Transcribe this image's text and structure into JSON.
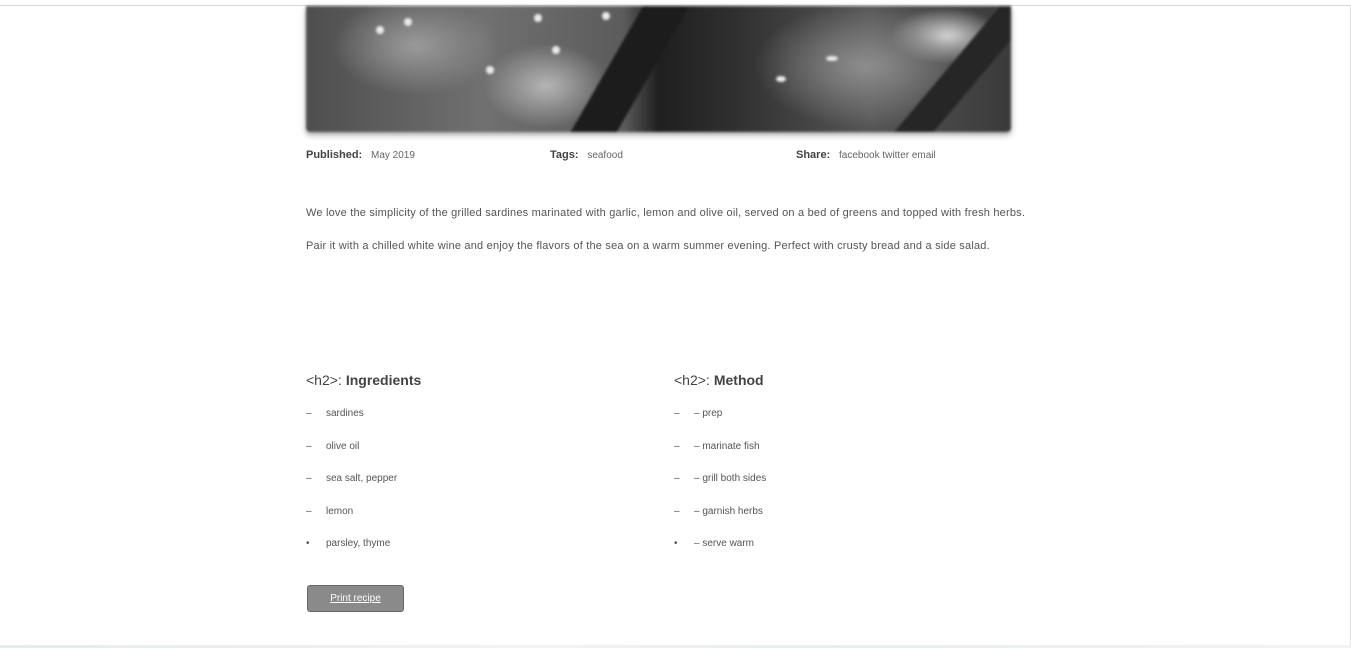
{
  "meta": [
    {
      "label": "Published:",
      "value": "May 2019"
    },
    {
      "label": "Tags:",
      "value": "seafood"
    },
    {
      "label": "Share:",
      "value": "facebook twitter email"
    }
  ],
  "intro": "We love the simplicity of the grilled sardines marinated with garlic, lemon and olive oil, served on a bed of greens and topped with fresh herbs. Pair it with a chilled white wine and enjoy the flavors of the sea on a warm summer evening. Perfect with crusty bread and a side salad.",
  "ingredients": {
    "tag": "<h2>:",
    "title": "Ingredients",
    "items": [
      {
        "mark": "–",
        "text": "sardines"
      },
      {
        "mark": "–",
        "text": "olive oil"
      },
      {
        "mark": "–",
        "text": "sea salt, pepper"
      },
      {
        "mark": "–",
        "text": "lemon"
      },
      {
        "mark": "•",
        "text": "parsley, thyme"
      }
    ]
  },
  "method": {
    "tag": "<h2>:",
    "title": "Method",
    "items": [
      {
        "mark": "–",
        "text": "– prep"
      },
      {
        "mark": "–",
        "text": "– marinate fish"
      },
      {
        "mark": "–",
        "text": "– grill both sides"
      },
      {
        "mark": "–",
        "text": "– garnish herbs"
      },
      {
        "mark": "•",
        "text": "– serve warm"
      }
    ]
  },
  "button": {
    "label": "Print recipe"
  }
}
